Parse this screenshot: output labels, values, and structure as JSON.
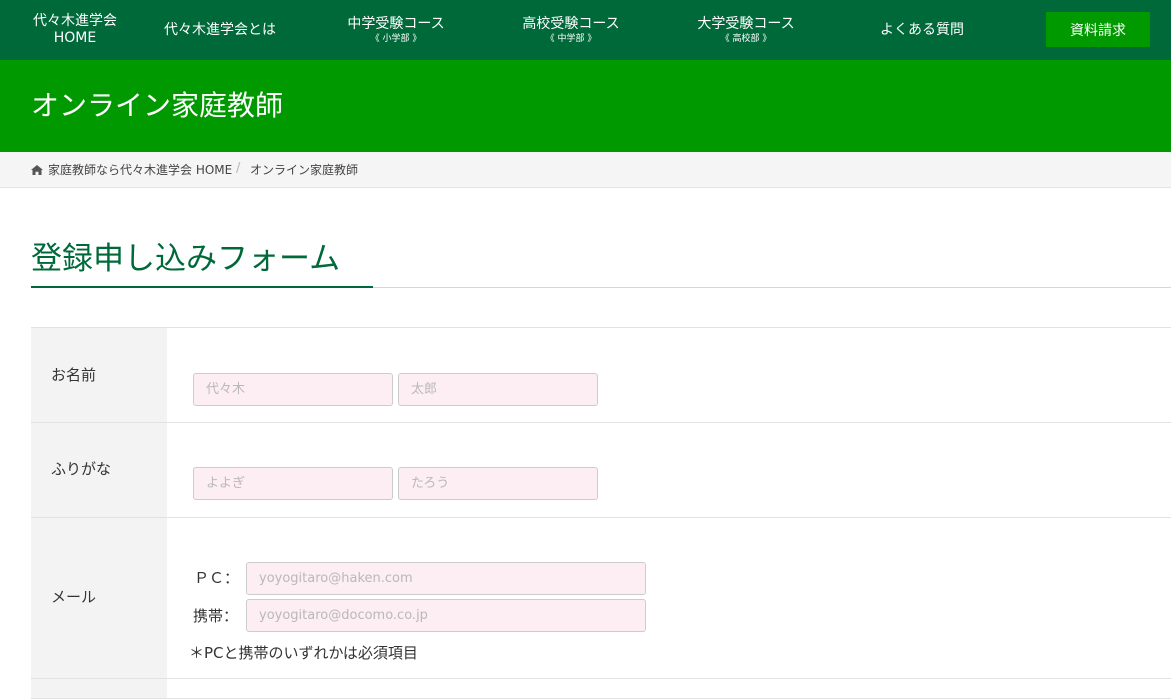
{
  "nav": {
    "home": {
      "main": "代々木進学会",
      "sub": "HOME"
    },
    "about": {
      "main": "代々木進学会とは"
    },
    "junior_high": {
      "main": "中学受験コース",
      "sub": "《 小学部 》"
    },
    "high_school": {
      "main": "高校受験コース",
      "sub": "《 中学部 》"
    },
    "university": {
      "main": "大学受験コース",
      "sub": "《 高校部 》"
    },
    "faq": {
      "main": "よくある質問"
    },
    "request_button": "資料請求"
  },
  "page_title": "オンライン家庭教師",
  "breadcrumb": {
    "home_icon": "home-icon",
    "home": "家庭教師なら代々木進学会 HOME",
    "separator": "/",
    "current": "オンライン家庭教師"
  },
  "section_title": "登録申し込みフォーム",
  "form": {
    "name": {
      "label": "お名前",
      "sei_placeholder": "代々木",
      "mei_placeholder": "太郎"
    },
    "kana": {
      "label": "ふりがな",
      "sei_placeholder": "よよぎ",
      "mei_placeholder": "たろう"
    },
    "mail": {
      "label": "メール",
      "pc_label": "ＰＣ：",
      "pc_placeholder": "yoyogitaro@haken.com",
      "mobile_label": "携帯：",
      "mobile_placeholder": "yoyogitaro@docomo.co.jp",
      "note": "＊PCと携帯のいずれかは必須項目"
    }
  },
  "colors": {
    "nav_bg": "#00693a",
    "title_band": "#009900",
    "request_button": "#009a00",
    "input_bg": "#fdeef3",
    "label_cell": "#f3f3f3"
  }
}
